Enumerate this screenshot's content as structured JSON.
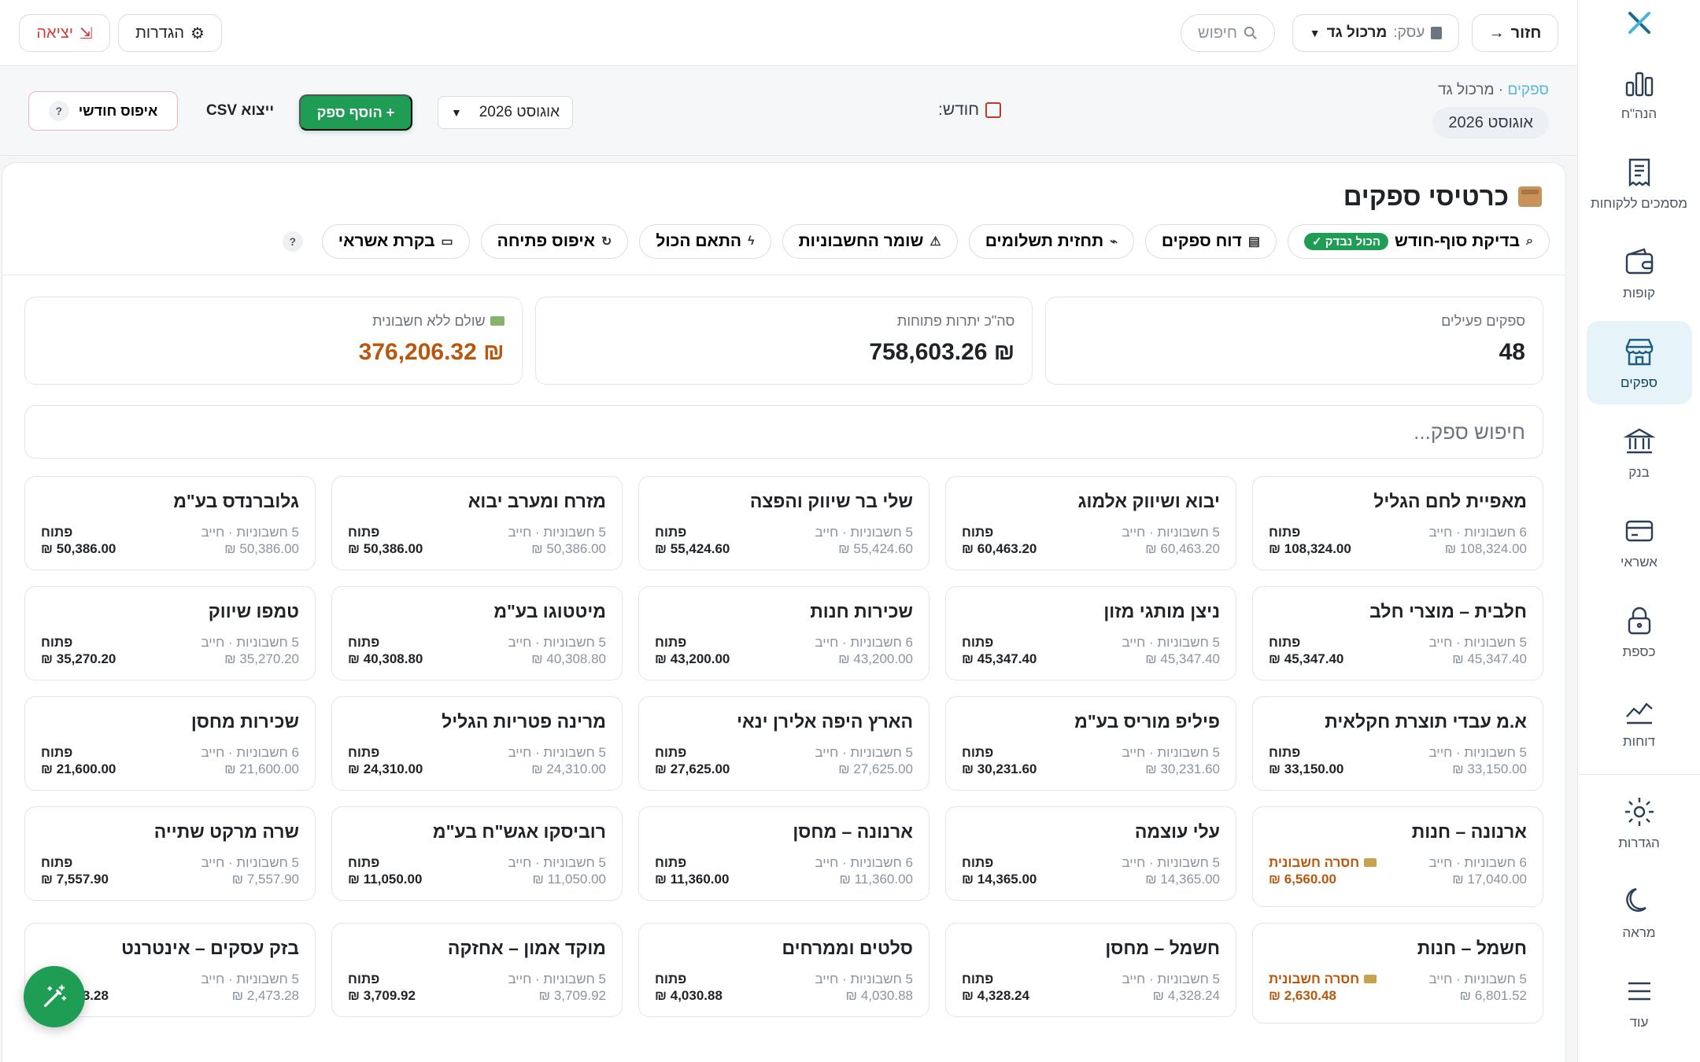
{
  "topbar": {
    "back_label": "חזור",
    "business_prefix": "עסק:",
    "business_name": "מרכול גד",
    "search_label": "חיפוש",
    "settings_label": "הגדרות",
    "logout_label": "יציאה"
  },
  "rail": {
    "items": [
      {
        "label": "הנה\"ח",
        "icon": "bar-chart-icon"
      },
      {
        "label": "מסמכים ללקוחות",
        "icon": "receipt-icon"
      },
      {
        "label": "קופות",
        "icon": "wallet-icon"
      },
      {
        "label": "ספקים",
        "icon": "store-icon",
        "active": true
      },
      {
        "label": "בנק",
        "icon": "bank-icon"
      },
      {
        "label": "אשראי",
        "icon": "credit-card-icon"
      },
      {
        "label": "כספת",
        "icon": "lock-icon"
      },
      {
        "label": "דוחות",
        "icon": "chart-line-icon"
      }
    ],
    "bottom": [
      {
        "label": "הגדרות",
        "icon": "gear-icon"
      },
      {
        "label": "מראה",
        "icon": "moon-icon"
      },
      {
        "label": "עוד",
        "icon": "menu-icon"
      }
    ]
  },
  "subheader": {
    "crumb_link": "ספקים",
    "crumb_sep": "·",
    "crumb_current": "מרכול גד",
    "month_pill": "אוגוסט 2026",
    "month_label": "חודש:",
    "month_value": "אוגוסט 2026",
    "add_supplier": "+ הוסף ספק",
    "export_csv": "ייצוא CSV",
    "monthly_reset": "איפוס חודשי"
  },
  "panel": {
    "title": "כרטיסי ספקים",
    "actions": {
      "month_end_check": "בדיקת סוף-חודש",
      "all_checked": "הכול נבדק ✓",
      "suppliers_report": "דוח ספקים",
      "payment_forecast": "תחזית תשלומים",
      "invoice_keeper": "שומר החשבוניות",
      "match_all": "התאם הכול",
      "opening_reset": "איפוס פתיחה",
      "credit_control": "בקרת אשראי",
      "help": "?"
    },
    "stats": {
      "active_label": "ספקים פעילים",
      "active_value": "48",
      "open_label": "סה\"כ יתרות פתוחות",
      "open_value": "₪ 758,603.26",
      "paid_label": "שולם ללא חשבונית",
      "paid_value": "₪ 376,206.32"
    },
    "search_placeholder": "חיפוש ספק..."
  },
  "suppliers": [
    {
      "name": "מאפיית לחם הגליל",
      "meta": "6 חשבוניות · חייב",
      "balance": "108,324.00 ₪",
      "status": "פתוח",
      "amount": "108,324.00 ₪"
    },
    {
      "name": "יבוא ושיווק אלמוג",
      "meta": "5 חשבוניות · חייב",
      "balance": "60,463.20 ₪",
      "status": "פתוח",
      "amount": "60,463.20 ₪"
    },
    {
      "name": "שלי בר שיווק והפצה",
      "meta": "5 חשבוניות · חייב",
      "balance": "55,424.60 ₪",
      "status": "פתוח",
      "amount": "55,424.60 ₪"
    },
    {
      "name": "מזרח ומערב יבוא",
      "meta": "5 חשבוניות · חייב",
      "balance": "50,386.00 ₪",
      "status": "פתוח",
      "amount": "50,386.00 ₪"
    },
    {
      "name": "גלוברנדס בע\"מ",
      "meta": "5 חשבוניות · חייב",
      "balance": "50,386.00 ₪",
      "status": "פתוח",
      "amount": "50,386.00 ₪"
    },
    {
      "name": "חלבית – מוצרי חלב",
      "meta": "5 חשבוניות · חייב",
      "balance": "45,347.40 ₪",
      "status": "פתוח",
      "amount": "45,347.40 ₪"
    },
    {
      "name": "ניצן מותגי מזון",
      "meta": "5 חשבוניות · חייב",
      "balance": "45,347.40 ₪",
      "status": "פתוח",
      "amount": "45,347.40 ₪"
    },
    {
      "name": "שכירות חנות",
      "meta": "6 חשבוניות · חייב",
      "balance": "43,200.00 ₪",
      "status": "פתוח",
      "amount": "43,200.00 ₪"
    },
    {
      "name": "מיטטוגו בע\"מ",
      "meta": "5 חשבוניות · חייב",
      "balance": "40,308.80 ₪",
      "status": "פתוח",
      "amount": "40,308.80 ₪"
    },
    {
      "name": "טמפו שיווק",
      "meta": "5 חשבוניות · חייב",
      "balance": "35,270.20 ₪",
      "status": "פתוח",
      "amount": "35,270.20 ₪"
    },
    {
      "name": "א.מ עבדי תוצרת חקלאית",
      "meta": "5 חשבוניות · חייב",
      "balance": "33,150.00 ₪",
      "status": "פתוח",
      "amount": "33,150.00 ₪"
    },
    {
      "name": "פיליפ מוריס בע\"מ",
      "meta": "5 חשבוניות · חייב",
      "balance": "30,231.60 ₪",
      "status": "פתוח",
      "amount": "30,231.60 ₪"
    },
    {
      "name": "הארץ היפה אלירן ינאי",
      "meta": "5 חשבוניות · חייב",
      "balance": "27,625.00 ₪",
      "status": "פתוח",
      "amount": "27,625.00 ₪"
    },
    {
      "name": "מרינה פטריות הגליל",
      "meta": "5 חשבוניות · חייב",
      "balance": "24,310.00 ₪",
      "status": "פתוח",
      "amount": "24,310.00 ₪"
    },
    {
      "name": "שכירות מחסן",
      "meta": "6 חשבוניות · חייב",
      "balance": "21,600.00 ₪",
      "status": "פתוח",
      "amount": "21,600.00 ₪"
    },
    {
      "name": "ארנונה – חנות",
      "meta": "6 חשבוניות · חייב",
      "balance": "17,040.00 ₪",
      "status": "חסרה חשבונית",
      "amount": "6,560.00 ₪",
      "missing": true
    },
    {
      "name": "עלי עוצמה",
      "meta": "5 חשבוניות · חייב",
      "balance": "14,365.00 ₪",
      "status": "פתוח",
      "amount": "14,365.00 ₪"
    },
    {
      "name": "ארנונה – מחסן",
      "meta": "6 חשבוניות · חייב",
      "balance": "11,360.00 ₪",
      "status": "פתוח",
      "amount": "11,360.00 ₪"
    },
    {
      "name": "רוביסקו אגש\"ח בע\"מ",
      "meta": "5 חשבוניות · חייב",
      "balance": "11,050.00 ₪",
      "status": "פתוח",
      "amount": "11,050.00 ₪"
    },
    {
      "name": "שרה מרקט שתייה",
      "meta": "5 חשבוניות · חייב",
      "balance": "7,557.90 ₪",
      "status": "פתוח",
      "amount": "7,557.90 ₪"
    },
    {
      "name": "חשמל – חנות",
      "meta": "5 חשבוניות · חייב",
      "balance": "6,801.52 ₪",
      "status": "חסרה חשבונית",
      "amount": "2,630.48 ₪",
      "missing": true
    },
    {
      "name": "חשמל – מחסן",
      "meta": "5 חשבוניות · חייב",
      "balance": "4,328.24 ₪",
      "status": "פתוח",
      "amount": "4,328.24 ₪"
    },
    {
      "name": "סלטים וממרחים",
      "meta": "5 חשבוניות · חייב",
      "balance": "4,030.88 ₪",
      "status": "פתוח",
      "amount": "4,030.88 ₪"
    },
    {
      "name": "מוקד אמון – אחזקה",
      "meta": "5 חשבוניות · חייב",
      "balance": "3,709.92 ₪",
      "status": "פתוח",
      "amount": "3,709.92 ₪"
    },
    {
      "name": "בזק עסקים – אינטרנט",
      "meta": "5 חשבוניות · חייב",
      "balance": "2,473.28 ₪",
      "status": "פתוח",
      "amount": "2,473.28 ₪"
    }
  ],
  "colors": {
    "accent_green": "#1f9d55",
    "warning_orange": "#b8570e",
    "logout_red": "#d33a3a",
    "active_rail_bg": "#e6f3f9"
  }
}
